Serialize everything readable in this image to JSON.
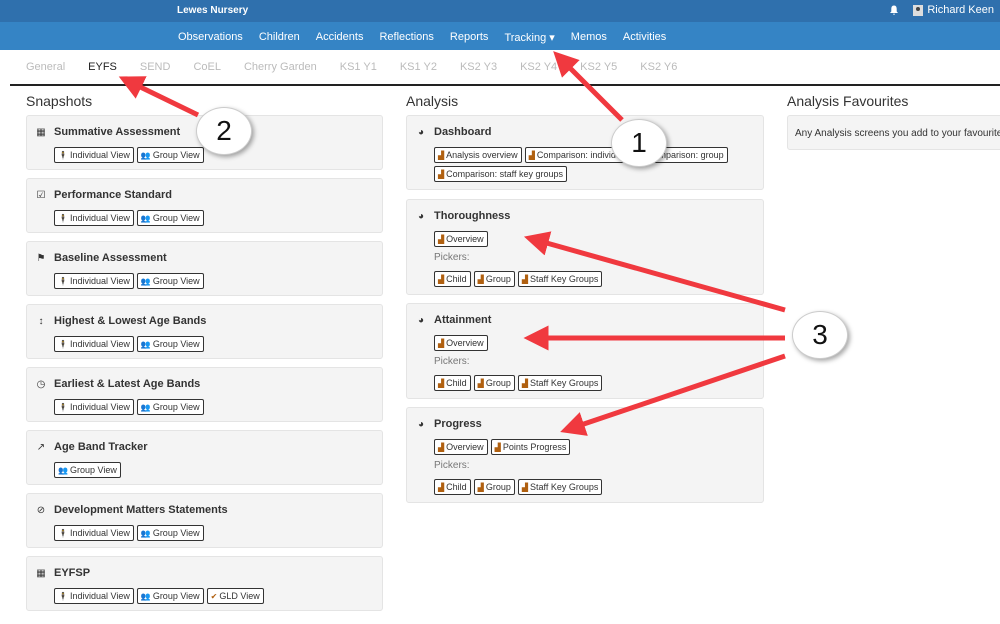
{
  "header": {
    "brand": "Lewes Nursery",
    "user": "Richard Keen"
  },
  "nav": [
    "Observations",
    "Children",
    "Accidents",
    "Reflections",
    "Reports",
    "Tracking ▾",
    "Memos",
    "Activities"
  ],
  "tabs": [
    {
      "label": "General",
      "active": false
    },
    {
      "label": "EYFS",
      "active": true
    },
    {
      "label": "SEND",
      "active": false
    },
    {
      "label": "CoEL",
      "active": false
    },
    {
      "label": "Cherry Garden",
      "active": false
    },
    {
      "label": "KS1 Y1",
      "active": false
    },
    {
      "label": "KS1 Y2",
      "active": false
    },
    {
      "label": "KS2 Y3",
      "active": false
    },
    {
      "label": "KS2 Y4",
      "active": false
    },
    {
      "label": "KS2 Y5",
      "active": false
    },
    {
      "label": "KS2 Y6",
      "active": false
    }
  ],
  "snapshots": {
    "title": "Snapshots",
    "cards": [
      {
        "icon": "calendar-icon",
        "glyph": "▦",
        "title": "Summative Assessment",
        "buttons": [
          "Individual View",
          "Group View"
        ]
      },
      {
        "icon": "calendar-check-icon",
        "glyph": "☑",
        "title": "Performance Standard",
        "buttons": [
          "Individual View",
          "Group View"
        ]
      },
      {
        "icon": "flag-icon",
        "glyph": "⚑",
        "title": "Baseline Assessment",
        "buttons": [
          "Individual View",
          "Group View"
        ]
      },
      {
        "icon": "arrows-vertical-icon",
        "glyph": "↕",
        "title": "Highest & Lowest Age Bands",
        "buttons": [
          "Individual View",
          "Group View"
        ]
      },
      {
        "icon": "clock-icon",
        "glyph": "◷",
        "title": "Earliest & Latest Age Bands",
        "buttons": [
          "Individual View",
          "Group View"
        ]
      },
      {
        "icon": "line-chart-icon",
        "glyph": "↗",
        "title": "Age Band Tracker",
        "buttons": [
          "Group View"
        ]
      },
      {
        "icon": "check-circle-icon",
        "glyph": "⊘",
        "title": "Development Matters Statements",
        "buttons": [
          "Individual View",
          "Group View"
        ]
      },
      {
        "icon": "calendar-icon",
        "glyph": "▦",
        "title": "EYFSP",
        "buttons": [
          "Individual View",
          "Group View",
          "GLD View"
        ]
      }
    ]
  },
  "analysis": {
    "title": "Analysis",
    "pickers_label": "Pickers:",
    "cards": [
      {
        "title": "Dashboard",
        "buttons": [
          "Analysis overview",
          "Comparison: individual",
          "Comparison: group",
          "Comparison: staff key groups"
        ],
        "pickers": []
      },
      {
        "title": "Thoroughness",
        "buttons": [
          "Overview"
        ],
        "pickers": [
          "Child",
          "Group",
          "Staff Key Groups"
        ]
      },
      {
        "title": "Attainment",
        "buttons": [
          "Overview"
        ],
        "pickers": [
          "Child",
          "Group",
          "Staff Key Groups"
        ]
      },
      {
        "title": "Progress",
        "buttons": [
          "Overview",
          "Points Progress"
        ],
        "pickers": [
          "Child",
          "Group",
          "Staff Key Groups"
        ]
      }
    ]
  },
  "favourites": {
    "title": "Analysis Favourites",
    "text": "Any Analysis screens you add to your favourites will appear here"
  },
  "annotations": [
    "1",
    "2",
    "3"
  ],
  "colors": {
    "topbar": "#2f70ad",
    "navbar": "#3584c5",
    "arrow": "#f0393f"
  }
}
